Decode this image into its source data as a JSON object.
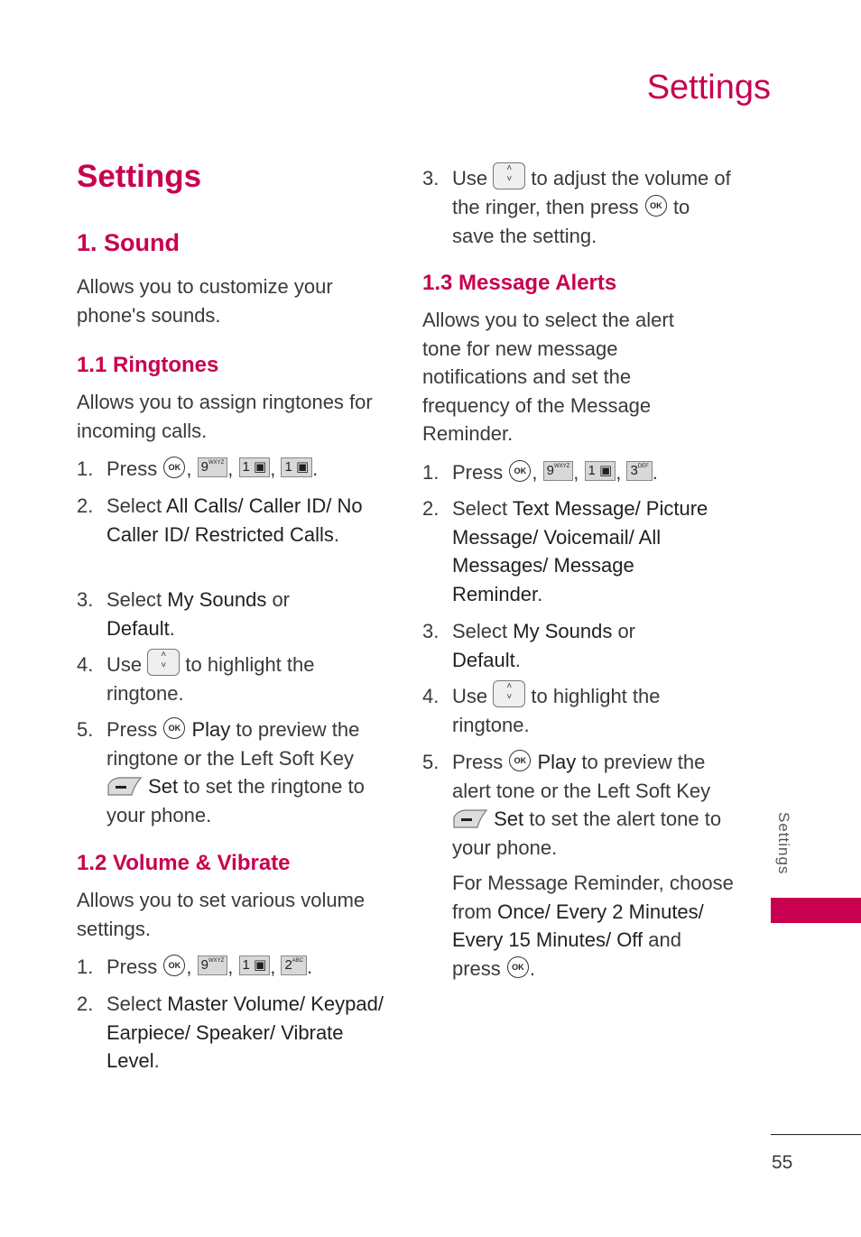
{
  "header": {
    "title": "Settings"
  },
  "left": {
    "title": "Settings",
    "sound_heading": "1. Sound",
    "sound_desc": "Allows you to customize your phone's sounds.",
    "ringtones": {
      "heading": "1.1 Ringtones",
      "desc": "Allows you to assign ringtones for incoming calls.",
      "steps": [
        {
          "num": "1.",
          "text": "Press",
          "keys": [
            "OK",
            "9 WXYZ",
            "1",
            "1"
          ]
        },
        {
          "num": "2.",
          "pre": "Select ",
          "bold": "All Calls/ Caller ID/ No Caller ID/ Restricted Calls",
          "post": "."
        },
        {
          "num": "3.",
          "pre": "Select ",
          "bold": "My Sounds",
          "mid": " or ",
          "bold2": "Default",
          "post": "."
        },
        {
          "num": "4.",
          "pre": "Use",
          "post": "to highlight the ringtone."
        },
        {
          "num": "5.",
          "pre": "Press",
          "bold": "Play",
          "mid": "to preview the ringtone or the Left Soft Key",
          "bold2": "Set",
          "post": "to set the ringtone to your phone."
        }
      ]
    },
    "volume": {
      "heading": "1.2 Volume & Vibrate",
      "desc": "Allows you to set various volume settings.",
      "steps": [
        {
          "num": "1.",
          "text": "Press",
          "keys": [
            "OK",
            "9 WXYZ",
            "1",
            "2 ABC"
          ]
        },
        {
          "num": "2.",
          "pre": "Select ",
          "bold": "Master Volume/ Keypad/ Earpiece/ Speaker/ Vibrate Level",
          "post": "."
        }
      ]
    }
  },
  "right": {
    "volume_step3": {
      "num": "3.",
      "pre": "Use",
      "mid": "to adjust the volume of the ringer, then press",
      "post": "to save the setting."
    },
    "alerts": {
      "heading": "1.3 Message Alerts",
      "desc": "Allows you to select the alert tone for new message notifications and set the frequency of the Message Reminder.",
      "steps": [
        {
          "num": "1.",
          "text": "Press",
          "keys": [
            "OK",
            "9 WXYZ",
            "1",
            "3 DEF"
          ]
        },
        {
          "num": "2.",
          "pre": "Select ",
          "bold": "Text Message/ Picture Message/ Voicemail/ All Messages/ Message Reminder",
          "post": "."
        },
        {
          "num": "3.",
          "pre": "Select ",
          "bold": "My Sounds",
          "mid": " or ",
          "bold2": "Default",
          "post": "."
        },
        {
          "num": "4.",
          "pre": "Use",
          "post": "to highlight the ringtone."
        },
        {
          "num": "5.",
          "pre": "Press",
          "bold": "Play",
          "mid": "to preview the alert tone or the Left Soft Key",
          "bold2": "Set",
          "post": "to set the alert tone to your phone."
        }
      ],
      "note": {
        "pre": "For Message Reminder, choose from ",
        "bold": "Once/ Every 2 Minutes/ Every 15 Minutes/ Off",
        "post": " and press"
      }
    }
  },
  "sidebar": {
    "label": "Settings",
    "accent_color": "#c8004f"
  },
  "footer": {
    "page_number": "55"
  }
}
